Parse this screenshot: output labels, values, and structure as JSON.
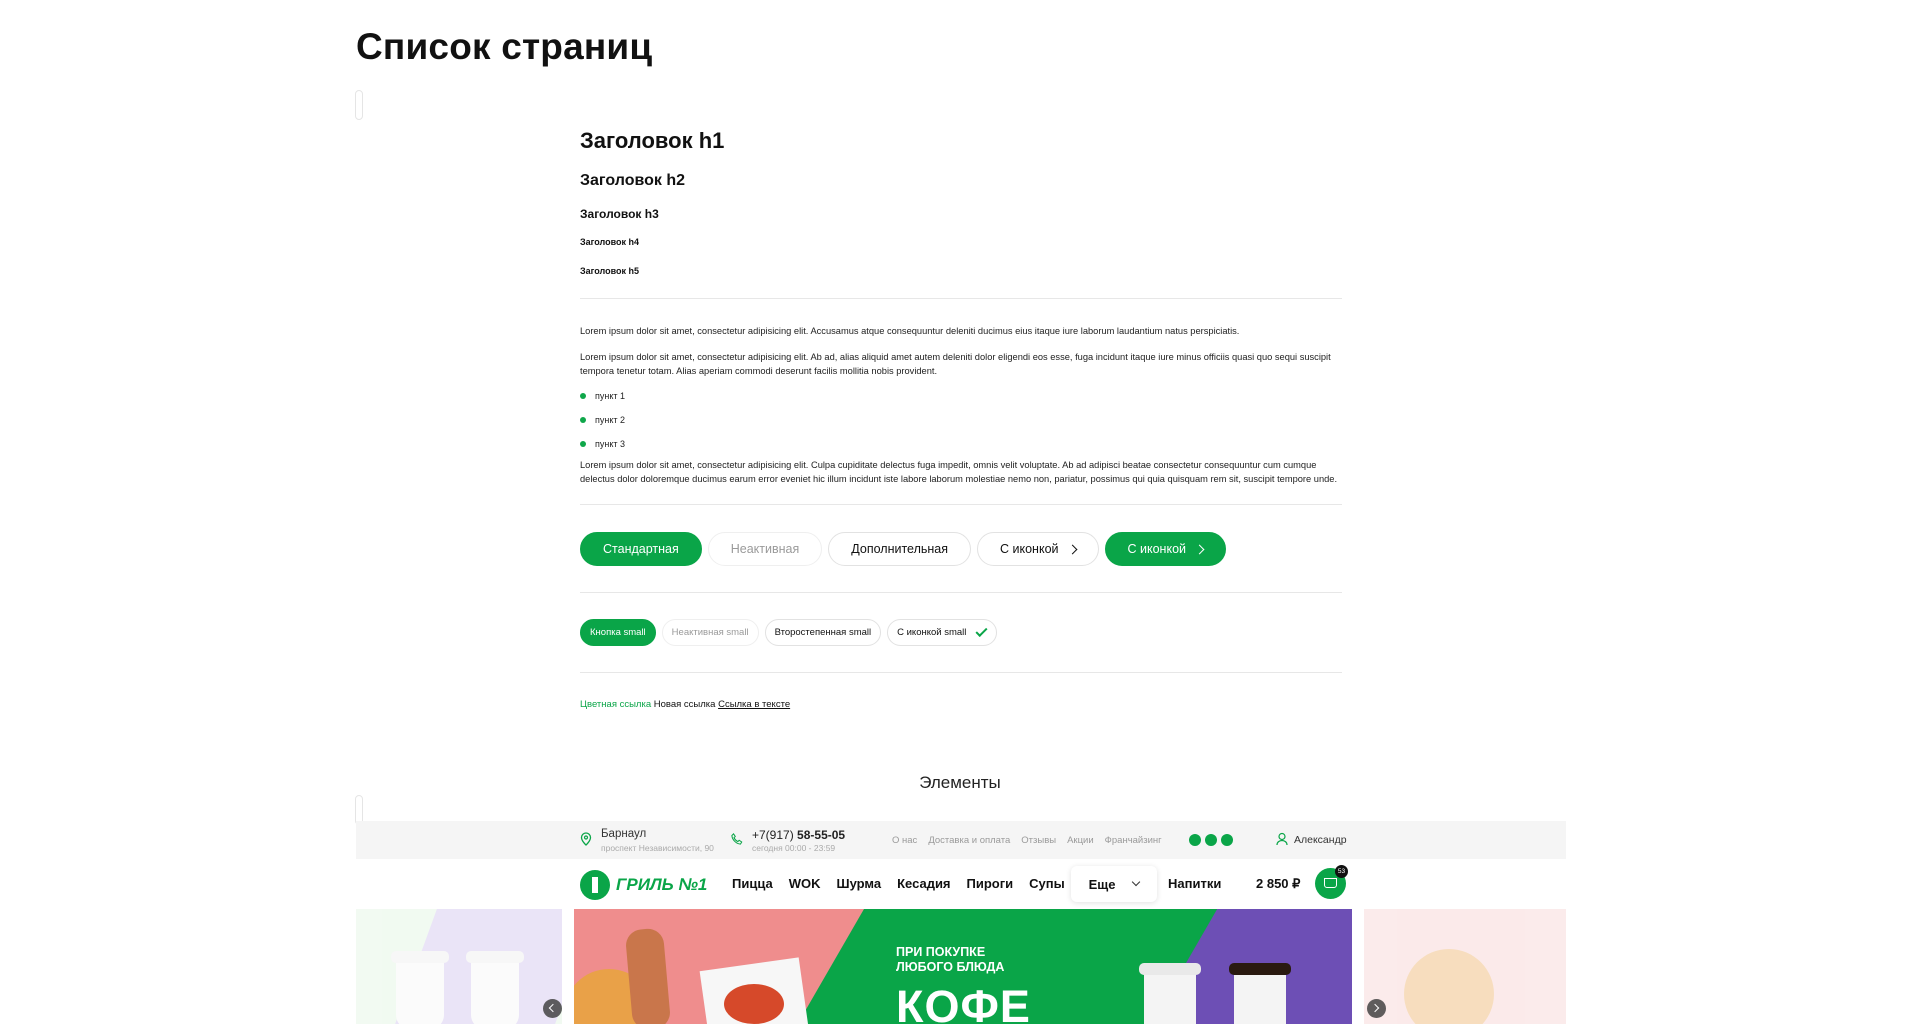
{
  "page": {
    "title": "Список страниц"
  },
  "typography": {
    "h1": "Заголовок h1",
    "h2": "Заголовок h2",
    "h3": "Заголовок h3",
    "h4": "Заголовок h4",
    "h5": "Заголовок h5"
  },
  "text": {
    "p1": "Lorem ipsum dolor sit amet, consectetur adipisicing elit. Accusamus atque consequuntur deleniti ducimus eius itaque iure laborum laudantium natus perspiciatis.",
    "p2": "Lorem ipsum dolor sit amet, consectetur adipisicing elit. Ab ad, alias aliquid amet autem deleniti dolor eligendi eos esse, fuga incidunt itaque iure minus officiis quasi quo sequi suscipit tempora tenetur totam. Alias aperiam commodi deserunt facilis mollitia nobis provident.",
    "list": [
      "пункт 1",
      "пункт 2",
      "пункт 3"
    ],
    "p3": "Lorem ipsum dolor sit amet, consectetur adipisicing elit. Culpa cupiditate delectus fuga impedit, omnis velit voluptate. Ab ad adipisci beatae consectetur consequuntur cum cumque delectus dolor doloremque ducimus earum error eveniet hic illum incidunt iste labore laborum molestiae nemo non, pariatur, possimus qui quia quisquam rem sit, suscipit tempore unde."
  },
  "buttons": {
    "standard": "Стандартная",
    "inactive": "Неактивная",
    "additional": "Дополнительная",
    "with_icon": "С иконкой",
    "with_icon_primary": "С иконкой"
  },
  "small_buttons": {
    "primary": "Кнопка small",
    "inactive": "Неактивная small",
    "secondary": "Второстепенная small",
    "with_icon": "С иконкой small"
  },
  "links": {
    "colored": "Цветная ссылка",
    "new": "Новая ссылка",
    "in_text": "Ссылка в тексте"
  },
  "elements_title": "Элементы",
  "header": {
    "city": "Барнаул",
    "address": "проспект Независимости, 90",
    "phone_prefix": "+7(917)",
    "phone_number": "58-55-05",
    "hours": "сегодня 00:00 - 23:59",
    "top_links": [
      "О нас",
      "Доставка и оплата",
      "Отзывы",
      "Акции",
      "Франчайзинг"
    ],
    "user_name": "Александр",
    "logo_text": "ГРИЛЬ №1",
    "nav": [
      "Пицца",
      "WOK",
      "Шурма",
      "Кесадия",
      "Пироги",
      "Супы"
    ],
    "more_label": "Еще",
    "drinks_label": "Напитки",
    "cart_total": "2 850 ₽",
    "cart_count": "53"
  },
  "banner": {
    "line1": "ПРИ ПОКУПКЕ",
    "line2": "ЛЮБОГО БЛЮДА",
    "big": "КОФЕ"
  },
  "colors": {
    "accent": "#0aa548",
    "purple": "#6d4fb5",
    "pink": "#ef8d8d"
  }
}
